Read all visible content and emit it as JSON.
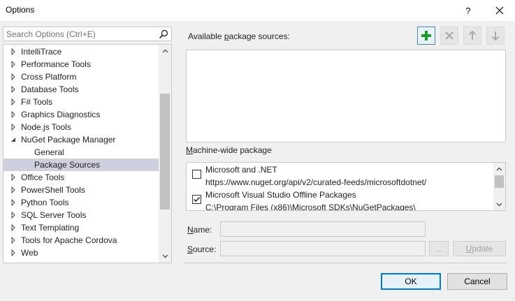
{
  "window": {
    "title": "Options",
    "help_glyph": "?"
  },
  "search": {
    "placeholder": "Search Options (Ctrl+E)"
  },
  "tree": {
    "items": [
      {
        "label": "IntelliTrace",
        "level": 0,
        "state": "collapsed"
      },
      {
        "label": "Performance Tools",
        "level": 0,
        "state": "collapsed"
      },
      {
        "label": "Cross Platform",
        "level": 0,
        "state": "collapsed"
      },
      {
        "label": "Database Tools",
        "level": 0,
        "state": "collapsed"
      },
      {
        "label": "F# Tools",
        "level": 0,
        "state": "collapsed"
      },
      {
        "label": "Graphics Diagnostics",
        "level": 0,
        "state": "collapsed"
      },
      {
        "label": "Node.js Tools",
        "level": 0,
        "state": "collapsed"
      },
      {
        "label": "NuGet Package Manager",
        "level": 0,
        "state": "expanded"
      },
      {
        "label": "General",
        "level": 1,
        "state": "leaf"
      },
      {
        "label": "Package Sources",
        "level": 1,
        "state": "leaf",
        "selected": true
      },
      {
        "label": "Office Tools",
        "level": 0,
        "state": "collapsed"
      },
      {
        "label": "PowerShell Tools",
        "level": 0,
        "state": "collapsed"
      },
      {
        "label": "Python Tools",
        "level": 0,
        "state": "collapsed"
      },
      {
        "label": "SQL Server Tools",
        "level": 0,
        "state": "collapsed"
      },
      {
        "label": "Text Templating",
        "level": 0,
        "state": "collapsed"
      },
      {
        "label": "Tools for Apache Cordova",
        "level": 0,
        "state": "collapsed"
      },
      {
        "label": "Web",
        "level": 0,
        "state": "collapsed"
      }
    ]
  },
  "available": {
    "label_pre": "Available ",
    "label_key": "p",
    "label_post": "ackage sources:"
  },
  "toolbar": {
    "add_icon": "plus-icon",
    "remove_icon": "x-icon",
    "up_icon": "arrow-up-icon",
    "down_icon": "arrow-down-icon",
    "accent_color": "#1e9a2a"
  },
  "machine_wide": {
    "label_key": "M",
    "label_rest": "achine-wide package",
    "items": [
      {
        "name": "Microsoft and .NET",
        "source": "https://www.nuget.org/api/v2/curated-feeds/microsoftdotnet/",
        "checked": false
      },
      {
        "name": "Microsoft Visual Studio Offline Packages",
        "source": "C:\\Program Files (x86)\\Microsoft SDKs\\NuGetPackages\\",
        "checked": true
      }
    ]
  },
  "form": {
    "name_key": "N",
    "name_rest": "ame:",
    "source_key": "S",
    "source_rest": "ource:",
    "name_value": "",
    "source_value": "",
    "browse_label": "...",
    "update_key": "U",
    "update_rest": "pdate"
  },
  "dialog": {
    "ok_label": "OK",
    "cancel_label": "Cancel"
  }
}
